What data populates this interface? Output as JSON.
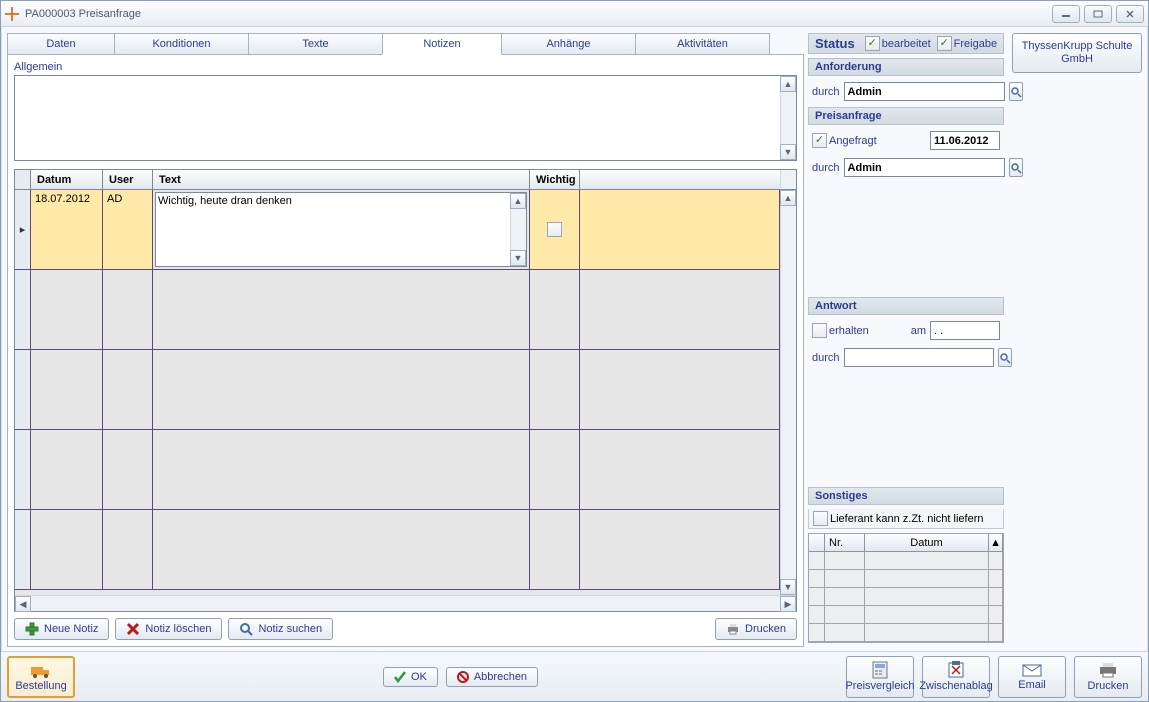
{
  "window": {
    "title": "PA000003 Preisanfrage"
  },
  "tabs": [
    "Daten",
    "Konditionen",
    "Texte",
    "Notizen",
    "Anhänge",
    "Aktivitäten"
  ],
  "tab_selected": 3,
  "allgemein_label": "Allgemein",
  "allgemein_text": "",
  "grid": {
    "headers": [
      "Datum",
      "User",
      "Text",
      "Wichtig"
    ],
    "rows": [
      {
        "datum": "18.07.2012",
        "user": "AD",
        "text": "Wichtig, heute dran denken",
        "wichtig": false
      }
    ]
  },
  "note_buttons": {
    "new": "Neue Notiz",
    "delete": "Notiz löschen",
    "search": "Notiz suchen",
    "print": "Drucken"
  },
  "footer": {
    "bestellung": "Bestellung",
    "ok": "OK",
    "cancel": "Abbrechen",
    "preisvergleich": "Preisvergleich",
    "zwischenablag": "Zwischenablag",
    "email": "Email",
    "drucken": "Drucken"
  },
  "side": {
    "status_label": "Status",
    "bearbeitet_label": "bearbeitet",
    "bearbeitet": true,
    "freigabe_label": "Freigabe",
    "freigabe": true,
    "anforderung_label": "Anforderung",
    "preisanfrage_label": "Preisanfrage",
    "durch_label": "durch",
    "anforderung_durch": "Admin",
    "angefragt_label": "Angefragt",
    "angefragt": true,
    "angefragt_date": "11.06.2012",
    "preisanfrage_durch": "Admin",
    "antwort_label": "Antwort",
    "erhalten_label": "erhalten",
    "erhalten": false,
    "am_label": "am",
    "am_value": ". .",
    "antwort_durch": "",
    "sonstiges_label": "Sonstiges",
    "lieferant_label": "Lieferant kann z.Zt. nicht liefern",
    "lieferant": false,
    "mini_headers": [
      "Nr.",
      "Datum"
    ]
  },
  "vendor": "ThyssenKrupp Schulte GmbH"
}
